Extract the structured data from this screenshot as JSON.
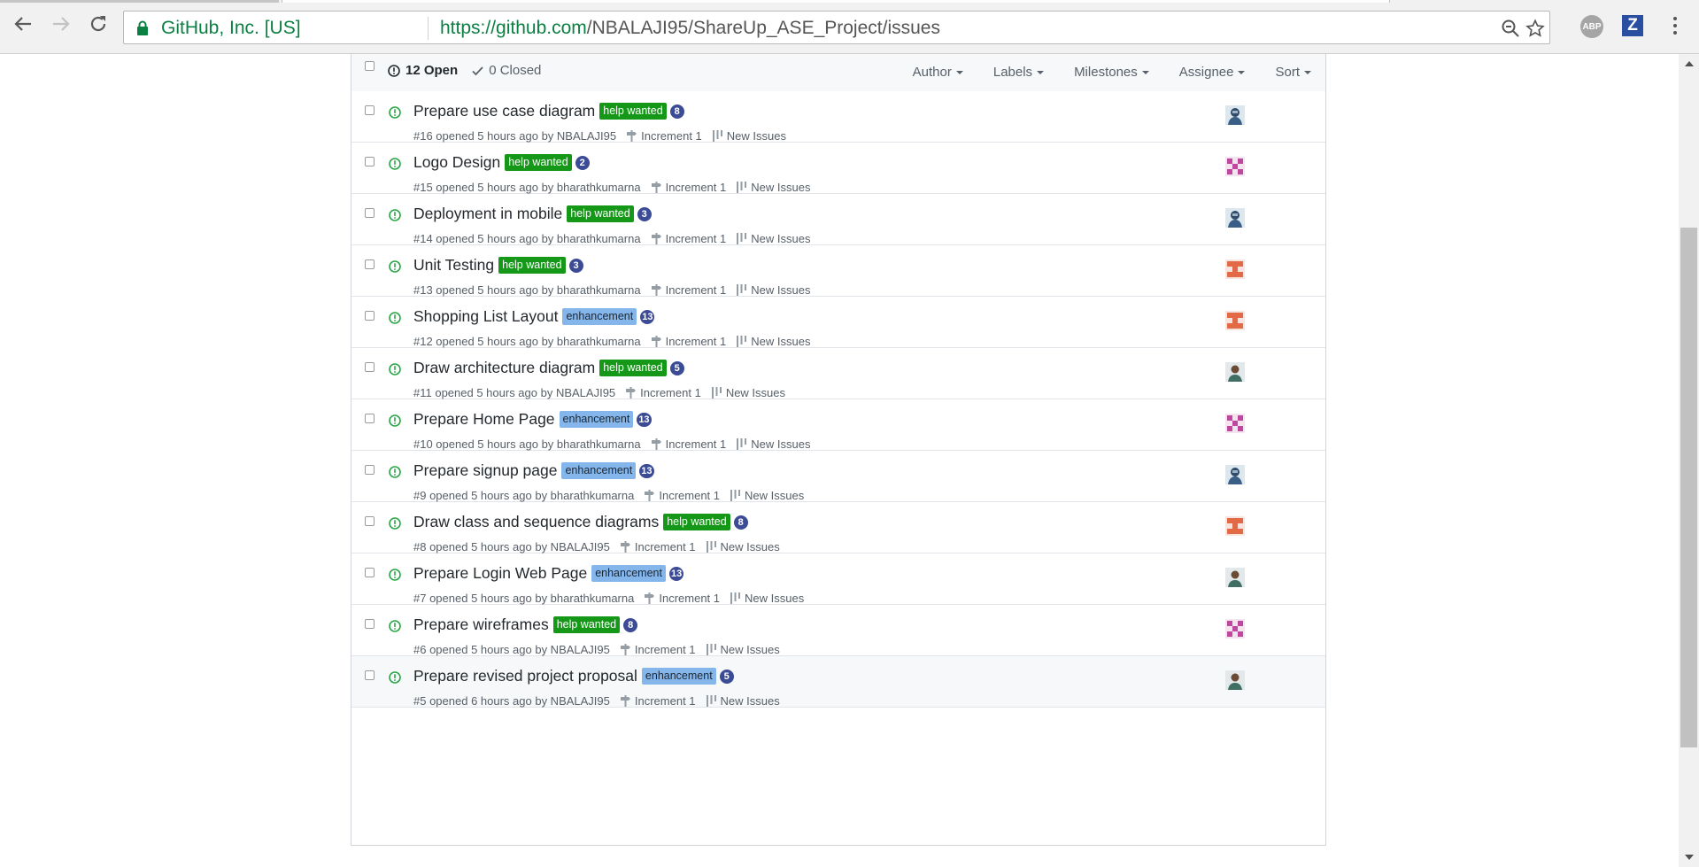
{
  "browser": {
    "site_identity": "GitHub, Inc. [US]",
    "url_host": "https://github.com",
    "url_path": "/NBALAJI95/ShareUp_ASE_Project/issues",
    "extensions": [
      "ABP",
      "Z"
    ],
    "icons": [
      "back-icon",
      "forward-icon",
      "reload-icon",
      "lock-icon",
      "zoom-icon",
      "star-icon",
      "menu-icon"
    ]
  },
  "header": {
    "open_count": "12 Open",
    "closed_count": "0 Closed",
    "filters": [
      "Author",
      "Labels",
      "Milestones",
      "Assignee",
      "Sort"
    ]
  },
  "colors": {
    "help_wanted": "#159818",
    "enhancement": "#84b6eb",
    "open_icon": "#28a745",
    "comment_badge": "#3b4b96",
    "link_green": "#0b8043"
  },
  "issues": [
    {
      "title": "Prepare use case diagram",
      "label": "help wanted",
      "label_type": "help",
      "comments": "8",
      "meta": "#16 opened 5 hours ago by NBALAJI95",
      "milestone": "Increment 1",
      "project": "New Issues",
      "avatar": "avatar-hooded"
    },
    {
      "title": "Logo Design",
      "label": "help wanted",
      "label_type": "help",
      "comments": "2",
      "meta": "#15 opened 5 hours ago by bharathkumarna",
      "milestone": "Increment 1",
      "project": "New Issues",
      "avatar": "avatar-pink"
    },
    {
      "title": "Deployment in mobile",
      "label": "help wanted",
      "label_type": "help",
      "comments": "3",
      "meta": "#14 opened 5 hours ago by bharathkumarna",
      "milestone": "Increment 1",
      "project": "New Issues",
      "avatar": "avatar-hooded"
    },
    {
      "title": "Unit Testing",
      "label": "help wanted",
      "label_type": "help",
      "comments": "3",
      "meta": "#13 opened 5 hours ago by bharathkumarna",
      "milestone": "Increment 1",
      "project": "New Issues",
      "avatar": "avatar-orange"
    },
    {
      "title": "Shopping List Layout",
      "label": "enhancement",
      "label_type": "enh",
      "comments": "13",
      "meta": "#12 opened 5 hours ago by bharathkumarna",
      "milestone": "Increment 1",
      "project": "New Issues",
      "avatar": "avatar-orange"
    },
    {
      "title": "Draw architecture diagram",
      "label": "help wanted",
      "label_type": "help",
      "comments": "5",
      "meta": "#11 opened 5 hours ago by NBALAJI95",
      "milestone": "Increment 1",
      "project": "New Issues",
      "avatar": "avatar-person"
    },
    {
      "title": "Prepare Home Page",
      "label": "enhancement",
      "label_type": "enh",
      "comments": "13",
      "meta": "#10 opened 5 hours ago by bharathkumarna",
      "milestone": "Increment 1",
      "project": "New Issues",
      "avatar": "avatar-pink"
    },
    {
      "title": "Prepare signup page",
      "label": "enhancement",
      "label_type": "enh",
      "comments": "13",
      "meta": "#9 opened 5 hours ago by bharathkumarna",
      "milestone": "Increment 1",
      "project": "New Issues",
      "avatar": "avatar-hooded"
    },
    {
      "title": "Draw class and sequence diagrams",
      "label": "help wanted",
      "label_type": "help",
      "comments": "8",
      "meta": "#8 opened 5 hours ago by NBALAJI95",
      "milestone": "Increment 1",
      "project": "New Issues",
      "avatar": "avatar-orange"
    },
    {
      "title": "Prepare Login Web Page",
      "label": "enhancement",
      "label_type": "enh",
      "comments": "13",
      "meta": "#7 opened 5 hours ago by bharathkumarna",
      "milestone": "Increment 1",
      "project": "New Issues",
      "avatar": "avatar-person"
    },
    {
      "title": "Prepare wireframes",
      "label": "help wanted",
      "label_type": "help",
      "comments": "8",
      "meta": "#6 opened 5 hours ago by NBALAJI95",
      "milestone": "Increment 1",
      "project": "New Issues",
      "avatar": "avatar-pink"
    },
    {
      "title": "Prepare revised project proposal",
      "label": "enhancement",
      "label_type": "enh",
      "comments": "5",
      "meta": "#5 opened 6 hours ago by NBALAJI95",
      "milestone": "Increment 1",
      "project": "New Issues",
      "avatar": "avatar-person"
    }
  ]
}
